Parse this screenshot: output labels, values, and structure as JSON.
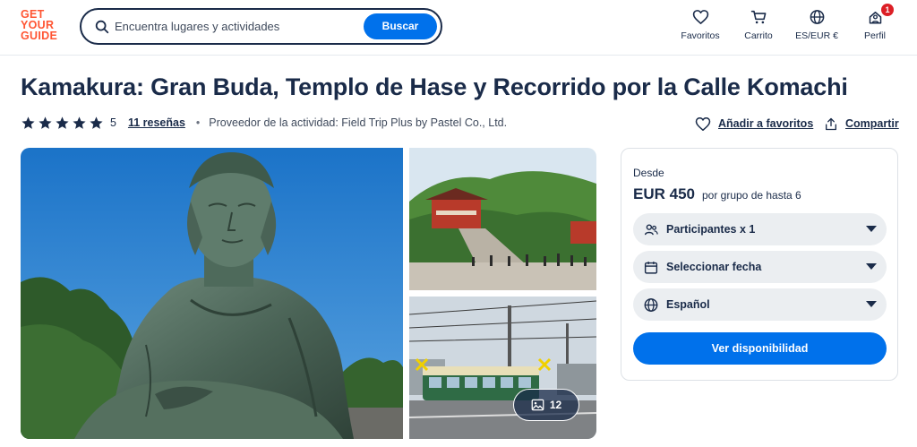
{
  "header": {
    "logo": [
      "GET",
      "YOUR",
      "GUIDE"
    ],
    "search_placeholder": "Encuentra lugares y actividades",
    "search_button": "Buscar",
    "nav": {
      "favorites": "Favoritos",
      "cart": "Carrito",
      "currency": "ES/EUR €",
      "profile": "Perfil",
      "profile_badge": "1"
    }
  },
  "title": "Kamakura: Gran Buda, Templo de Hase y Recorrido por la Calle Komachi",
  "rating": {
    "stars": 5,
    "score": "5",
    "reviews": "11 reseñas",
    "separator": "•",
    "provider": "Proveedor de la actividad: Field Trip Plus by Pastel Co., Ltd."
  },
  "actions": {
    "favorite": "Añadir a favoritos",
    "share": "Compartir"
  },
  "gallery": {
    "photo_count": "12"
  },
  "booking": {
    "from_label": "Desde",
    "price": "EUR 450",
    "price_unit": "por grupo de hasta 6",
    "participants": "Participantes x 1",
    "date": "Seleccionar fecha",
    "language": "Español",
    "cta": "Ver disponibilidad"
  },
  "colors": {
    "brand": "#ff5533",
    "primary": "#0071eb",
    "text": "#1a2b49",
    "badge": "#dc1f26"
  }
}
